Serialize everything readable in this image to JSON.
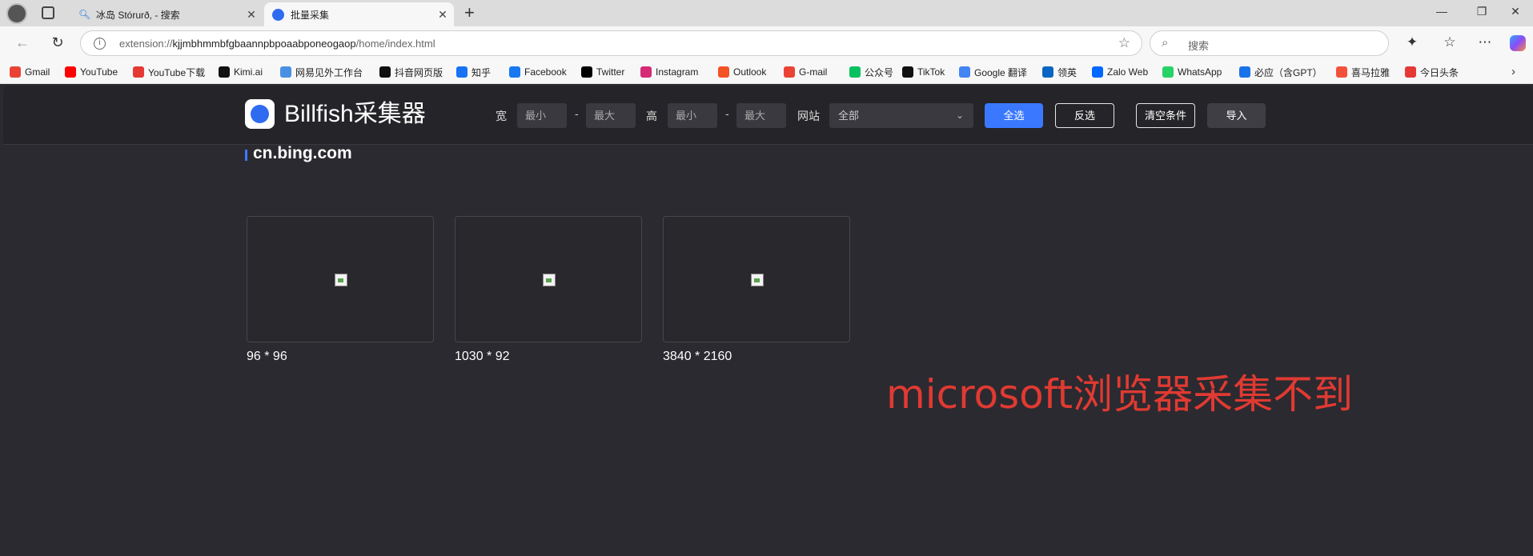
{
  "browser": {
    "tabs": [
      {
        "title": "冰岛 Stórurð, - 搜索",
        "active": false
      },
      {
        "title": "批量采集",
        "active": true
      }
    ],
    "url": {
      "scheme": "extension://",
      "host": "kjjmbhmmbfgbaannpbpoaabponeogaop",
      "path": "/home/index.html"
    },
    "search_placeholder": "搜索",
    "bookmarks": [
      {
        "label": "Gmail",
        "color": "#ea4335"
      },
      {
        "label": "YouTube",
        "color": "#ff0000"
      },
      {
        "label": "YouTube下载",
        "color": "#e53935"
      },
      {
        "label": "Kimi.ai",
        "color": "#111111"
      },
      {
        "label": "网易见外工作台",
        "color": "#4a90e2"
      },
      {
        "label": "抖音网页版",
        "color": "#111111"
      },
      {
        "label": "知乎",
        "color": "#1772f6"
      },
      {
        "label": "Facebook",
        "color": "#1877f2"
      },
      {
        "label": "Twitter",
        "color": "#000000"
      },
      {
        "label": "Instagram",
        "color": "#d62976"
      },
      {
        "label": "Outlook",
        "color": "#f35325"
      },
      {
        "label": "G-mail",
        "color": "#ea4335"
      },
      {
        "label": "公众号",
        "color": "#07c160"
      },
      {
        "label": "TikTok",
        "color": "#111111"
      },
      {
        "label": "Google 翻译",
        "color": "#4285f4"
      },
      {
        "label": "领英",
        "color": "#0a66c2"
      },
      {
        "label": "Zalo Web",
        "color": "#0068ff"
      },
      {
        "label": "WhatsApp",
        "color": "#25d366"
      },
      {
        "label": "必应（含GPT）",
        "color": "#1a73e8"
      },
      {
        "label": "喜马拉雅",
        "color": "#f5503a"
      },
      {
        "label": "今日头条",
        "color": "#e53935"
      }
    ]
  },
  "app": {
    "brand": "Billfish采集器",
    "filters": {
      "width_label": "宽",
      "height_label": "高",
      "site_label": "网站",
      "min_placeholder": "最小",
      "max_placeholder": "最大",
      "range_sep": "-",
      "site_value": "全部"
    },
    "buttons": {
      "select_all": "全选",
      "invert": "反选",
      "clear": "清空条件",
      "import": "导入"
    },
    "section": {
      "title": "cn.bing.com",
      "images": [
        {
          "dims": "96 * 96"
        },
        {
          "dims": "1030 * 92"
        },
        {
          "dims": "3840 * 2160"
        }
      ]
    }
  },
  "annotation": "microsoft浏览器采集不到"
}
